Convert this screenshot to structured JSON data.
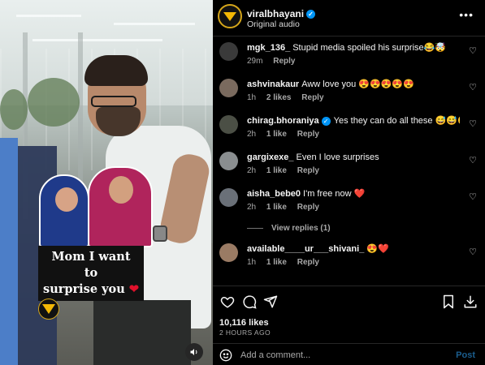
{
  "header": {
    "username": "viralbhayani",
    "subtitle": "Original audio",
    "more_icon": "more-horizontal-icon",
    "verified_icon": "verified-badge-icon"
  },
  "media": {
    "caption_line1": "Mom I want to",
    "caption_line2": "surprise you",
    "caption_emoji": "❤",
    "sound_icon": "speaker-icon"
  },
  "comments": [
    {
      "user": "mgk_136_",
      "text": "Stupid media spoiled his surprise😂🤯",
      "time": "29m",
      "likes": "",
      "reply": "Reply",
      "avatar_color": "#3a3a3a"
    },
    {
      "user": "ashvinakaur",
      "text": "Aww love you 😍😍😍😍😍",
      "time": "1h",
      "likes": "2 likes",
      "reply": "Reply",
      "avatar_color": "#7a6a5e"
    },
    {
      "user": "chirag.bhoraniya",
      "text": "Yes they can do all these 😅😅😅",
      "time": "2h",
      "likes": "1 like",
      "reply": "Reply",
      "avatar_color": "#4b4f45",
      "verified": true
    },
    {
      "user": "gargixexe_",
      "text": "Even I love surprises",
      "time": "2h",
      "likes": "1 like",
      "reply": "Reply",
      "avatar_color": "#8a8e90"
    },
    {
      "user": "aisha_bebe0",
      "text": "I'm free now ❤️",
      "time": "2h",
      "likes": "1 like",
      "reply": "Reply",
      "avatar_color": "#6a7078"
    },
    {
      "user": "available____ur___shivani_",
      "text": "😍❤️",
      "time": "1h",
      "likes": "1 like",
      "reply": "Reply",
      "avatar_color": "#9a7b64"
    }
  ],
  "view_replies": "View replies (1)",
  "actions": {
    "like_icon": "heart-icon",
    "comment_icon": "comment-icon",
    "share_icon": "share-icon",
    "save_icon": "bookmark-icon",
    "download_icon": "download-icon"
  },
  "likes": "10,116 likes",
  "time_ago": "2 HOURS AGO",
  "add_comment": {
    "placeholder": "Add a comment...",
    "post_label": "Post",
    "emoji_icon": "emoji-icon"
  },
  "colors": {
    "accent": "#0095f6",
    "post_disabled": "#1b5e8f",
    "heart_red": "#e0112b",
    "logo_gold": "#f2b705"
  }
}
